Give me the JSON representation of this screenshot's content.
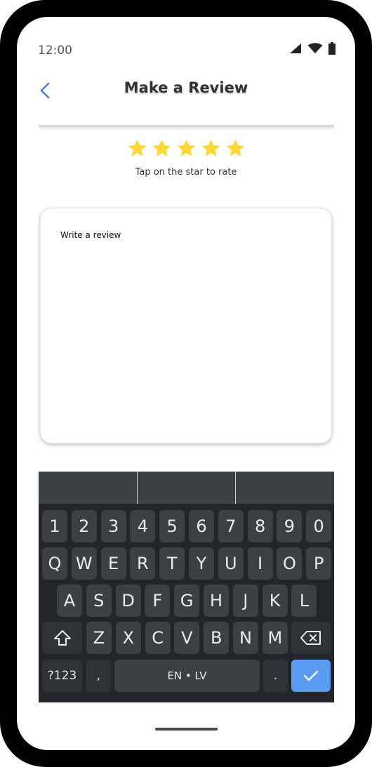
{
  "status_bar": {
    "time": "12:00",
    "icons": [
      "signal-icon",
      "wifi-icon",
      "battery-icon"
    ]
  },
  "app_bar": {
    "title": "Make a Review",
    "back_icon": "chevron-left-icon"
  },
  "rating": {
    "stars_total": 5,
    "stars_selected": 5,
    "hint": "Tap on the star to rate",
    "star_color": "#FDD835"
  },
  "review": {
    "placeholder": "Write a review",
    "value": ""
  },
  "keyboard": {
    "suggestions": [
      "",
      "",
      ""
    ],
    "row_numbers": [
      "1",
      "2",
      "3",
      "4",
      "5",
      "6",
      "7",
      "8",
      "9",
      "0"
    ],
    "row_top": [
      "Q",
      "W",
      "E",
      "R",
      "T",
      "Y",
      "U",
      "I",
      "O",
      "P"
    ],
    "row_middle": [
      "A",
      "S",
      "D",
      "F",
      "G",
      "H",
      "J",
      "K",
      "L"
    ],
    "row_bottom": [
      "Z",
      "X",
      "C",
      "V",
      "B",
      "N",
      "M"
    ],
    "symbols_label": "?123",
    "comma_label": ",",
    "space_label": "EN • LV",
    "period_label": ".",
    "enter_color": "#5B9CF3"
  },
  "colors": {
    "accent": "#4A7BE0",
    "keyboard_bg": "#22262A",
    "key_bg": "#3C4043"
  }
}
